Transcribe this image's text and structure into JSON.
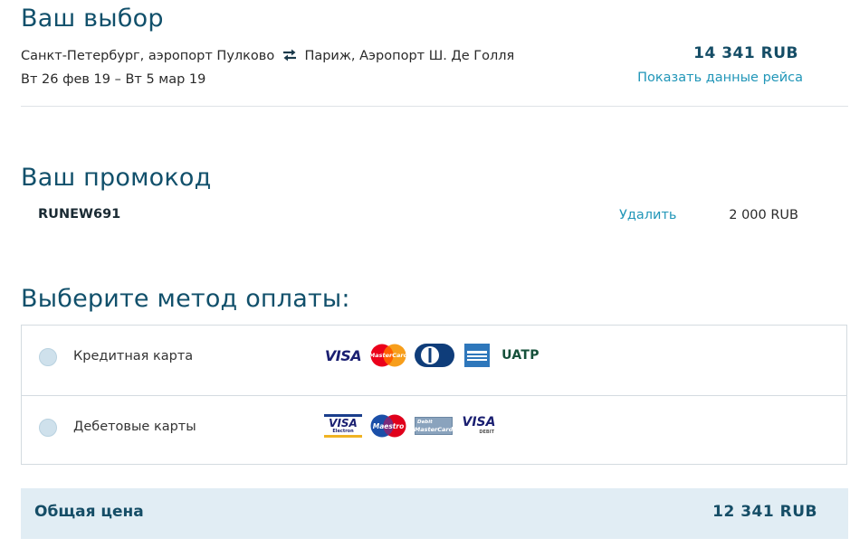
{
  "choice": {
    "heading": "Ваш выбор",
    "route_from": "Санкт-Петербург, аэропорт Пулково",
    "route_to": "Париж, Аэропорт Ш. Де Голля",
    "dates": "Вт 26 фев 19 – Вт 5 мар 19",
    "price": "14 341 RUB",
    "details_link": "Показать данные рейса"
  },
  "promo": {
    "heading": "Ваш промокод",
    "code": "RUNEW691",
    "remove_label": "Удалить",
    "discount": "2 000 RUB"
  },
  "payment": {
    "heading": "Выберите метод оплаты:",
    "methods": [
      {
        "label": "Кредитная карта",
        "logos": [
          "visa",
          "mastercard",
          "diners-club",
          "american-express",
          "uatp"
        ]
      },
      {
        "label": "Дебетовые карты",
        "logos": [
          "visa-electron",
          "maestro",
          "debit-mastercard",
          "visa-debit"
        ]
      }
    ],
    "logo_text": {
      "visa": "VISA",
      "mastercard": "MasterCard",
      "uatp": "UATP",
      "visa_electron": "VISA",
      "visa_electron_sub": "Electron",
      "maestro": "Maestro",
      "debit_mc_top": "Debit",
      "debit_mc_bottom": "MasterCard",
      "visa_debit": "VISA",
      "visa_debit_sub": "DEBIT"
    }
  },
  "total": {
    "label": "Общая цена",
    "price": "12 341 RUB"
  },
  "icons": {
    "roundtrip": "roundtrip-arrows-icon"
  },
  "colors": {
    "heading": "#11506b",
    "link": "#2196b8",
    "total_bg": "#e1edf4",
    "radio": "#cfe1ec"
  }
}
